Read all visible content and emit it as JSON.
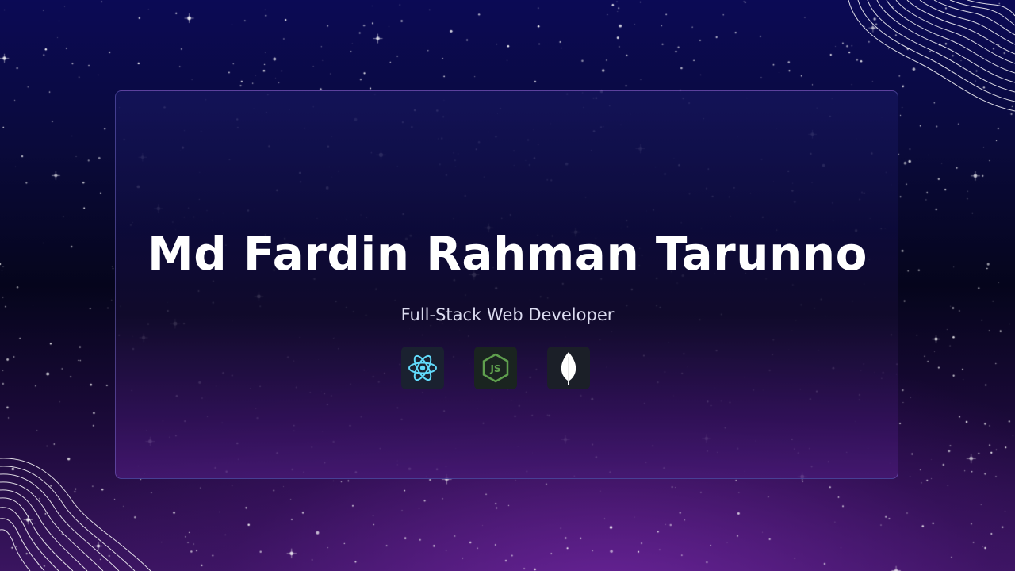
{
  "hero": {
    "name": "Md Fardin Rahman Tarunno",
    "role": "Full-Stack Web Developer"
  },
  "tech_icons": [
    {
      "icon": "react-icon",
      "color": "#61dafb"
    },
    {
      "icon": "nodejs-icon",
      "color": "#5fa04e"
    },
    {
      "icon": "mongodb-icon",
      "color": "#ffffff"
    }
  ],
  "colors": {
    "background_top": "#0b0a55",
    "background_mid": "#05051c",
    "background_bottom": "#3a1560",
    "card_border": "#8278dc",
    "title": "#ffffff",
    "subtitle": "#dcdcf0"
  }
}
